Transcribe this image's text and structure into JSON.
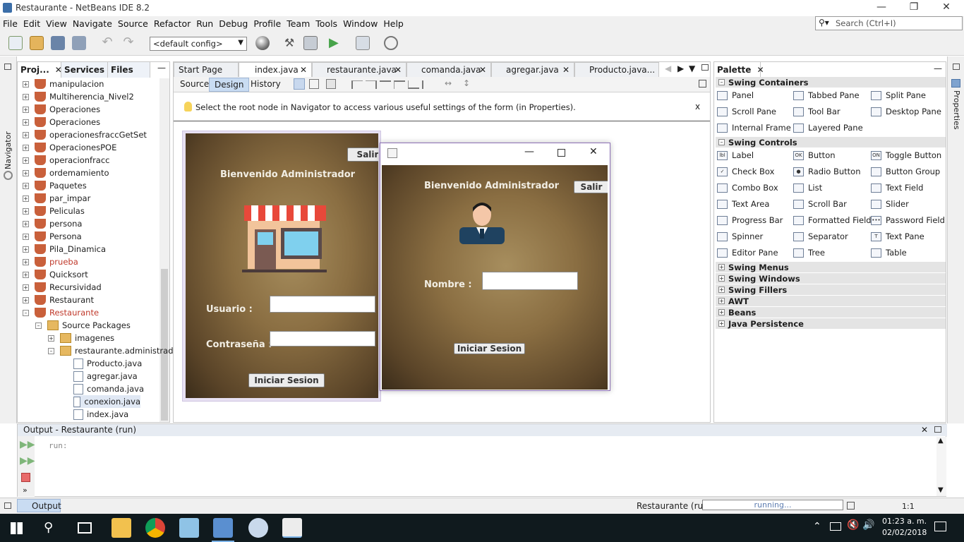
{
  "window": {
    "title": "Restaurante - NetBeans IDE 8.2"
  },
  "menu": [
    "File",
    "Edit",
    "View",
    "Navigate",
    "Source",
    "Refactor",
    "Run",
    "Debug",
    "Profile",
    "Team",
    "Tools",
    "Window",
    "Help"
  ],
  "search": {
    "placeholder": "Search (Ctrl+I)"
  },
  "toolbar": {
    "config": "<default config>"
  },
  "nav_strip": {
    "label": "Navigator"
  },
  "projects": {
    "tabs": [
      "Proj...",
      "Services",
      "Files"
    ],
    "items": [
      {
        "label": "manipulacion",
        "color": "#000000"
      },
      {
        "label": "Multiherencia_Nivel2",
        "color": "#000000"
      },
      {
        "label": "Operaciones",
        "color": "#000000"
      },
      {
        "label": "Operaciones",
        "color": "#000000"
      },
      {
        "label": "operacionesfraccGetSet",
        "color": "#000000"
      },
      {
        "label": "OperacionesPOE",
        "color": "#000000"
      },
      {
        "label": "operacionfracc",
        "color": "#000000"
      },
      {
        "label": "ordemamiento",
        "color": "#000000"
      },
      {
        "label": "Paquetes",
        "color": "#000000"
      },
      {
        "label": "par_impar",
        "color": "#000000"
      },
      {
        "label": "Peliculas",
        "color": "#000000"
      },
      {
        "label": "persona",
        "color": "#000000"
      },
      {
        "label": "Persona",
        "color": "#000000"
      },
      {
        "label": "Pila_Dinamica",
        "color": "#000000"
      },
      {
        "label": "prueba",
        "color": "#c0392b"
      },
      {
        "label": "Quicksort",
        "color": "#000000"
      },
      {
        "label": "Recursividad",
        "color": "#000000"
      },
      {
        "label": "Restaurant",
        "color": "#000000"
      },
      {
        "label": "Restaurante",
        "color": "#c0392b"
      }
    ],
    "source_packages": "Source Packages",
    "packages": [
      "imagenes",
      "restaurante.administrad"
    ],
    "files": [
      "Producto.java",
      "agregar.java",
      "comanda.java",
      "conexion.java",
      "index.java"
    ]
  },
  "editor": {
    "tabs": [
      "Start Page",
      "index.java",
      "restaurante.java",
      "comanda.java",
      "agregar.java",
      "Producto.java..."
    ],
    "subtabs": [
      "Source",
      "Design",
      "History"
    ],
    "hint": "Select the root node in Navigator to access various useful settings of the form (in Properties).",
    "hint_close": "x"
  },
  "form1": {
    "salir": "Salir",
    "welcome": "Bienvenido Administrador",
    "usuario": "Usuario :",
    "contrasena": "Contraseña :",
    "iniciar": "Iniciar Sesion"
  },
  "form2": {
    "salir": "Salir",
    "welcome": "Bienvenido Administrador",
    "nombre": "Nombre :",
    "iniciar": "Iniciar Sesion"
  },
  "palette": {
    "title": "Palette",
    "swing_containers": "Swing Containers",
    "containers": [
      "Panel",
      "Tabbed Pane",
      "Split Pane",
      "Scroll Pane",
      "Tool Bar",
      "Desktop Pane",
      "Internal Frame",
      "Layered Pane"
    ],
    "swing_controls": "Swing Controls",
    "controls": [
      "Label",
      "Button",
      "Toggle Button",
      "Check Box",
      "Radio Button",
      "Button Group",
      "Combo Box",
      "List",
      "Text Field",
      "Text Area",
      "Scroll Bar",
      "Slider",
      "Progress Bar",
      "Formatted Field",
      "Password Field",
      "Spinner",
      "Separator",
      "Text Pane",
      "Editor Pane",
      "Tree",
      "Table"
    ],
    "collapsed": [
      "Swing Menus",
      "Swing Windows",
      "Swing Fillers",
      "AWT",
      "Beans",
      "Java Persistence"
    ]
  },
  "right_strip": {
    "label": "Properties"
  },
  "output": {
    "title": "Output - Restaurante (run)",
    "text": "run:",
    "tab": "Output"
  },
  "status": {
    "project": "Restaurante (run)",
    "progress": "running...",
    "position": "1:1"
  },
  "taskbar": {
    "time": "01:23 a. m.",
    "date": "02/02/2018"
  }
}
